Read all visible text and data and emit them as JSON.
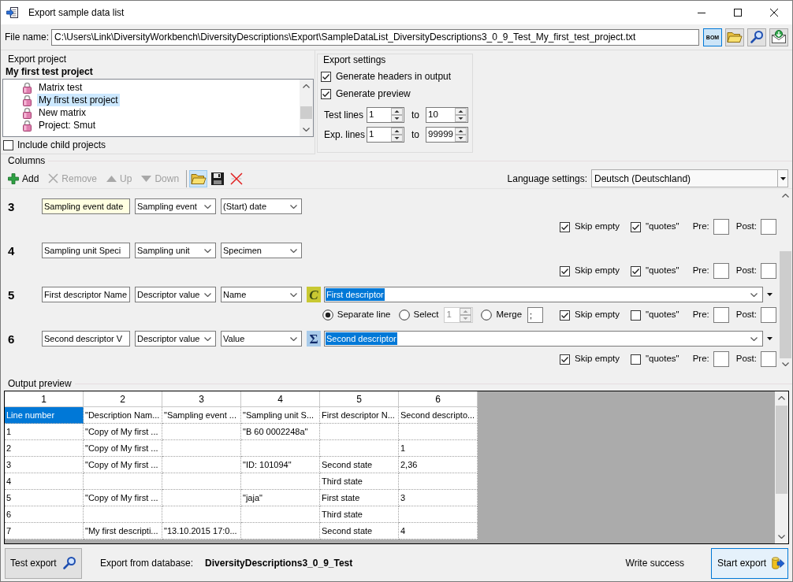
{
  "window": {
    "title": "Export sample data list"
  },
  "file_row": {
    "label": "File name:",
    "path": "C:\\Users\\Link\\DiversityWorkbench\\DiversityDescriptions\\Export\\SampleDataList_DiversityDescriptions3_0_9_Test_My_first_test_project.txt",
    "buttons": [
      {
        "kind": "bom",
        "label": "BOM",
        "pressed": true
      },
      {
        "kind": "folder",
        "pressed": false
      },
      {
        "kind": "search",
        "pressed": false
      },
      {
        "kind": "mail",
        "pressed": false
      }
    ]
  },
  "export_project": {
    "title": "Export project",
    "current": "My first test project",
    "projects": [
      {
        "name": "Matrix test",
        "selected": false
      },
      {
        "name": "My first test project",
        "selected": true
      },
      {
        "name": "New matrix",
        "selected": false
      },
      {
        "name": "Project: Smut",
        "selected": false
      }
    ],
    "include_child": {
      "label": "Include child projects",
      "checked": false
    }
  },
  "export_settings": {
    "title": "Export settings",
    "options": [
      {
        "label": "Generate headers in output",
        "checked": true
      },
      {
        "label": "Generate preview",
        "checked": true
      }
    ],
    "ranges": [
      {
        "label": "Test lines",
        "from": "1",
        "to_label": "to",
        "to": "10"
      },
      {
        "label": "Exp. lines",
        "from": "1",
        "to_label": "to",
        "to": "99999"
      }
    ]
  },
  "columns": {
    "title": "Columns",
    "toolbar": [
      {
        "kind": "add",
        "label": "Add",
        "disabled": false,
        "highlighted": false
      },
      {
        "kind": "remove",
        "label": "Remove",
        "disabled": true,
        "highlighted": false
      },
      {
        "kind": "up",
        "label": "Up",
        "disabled": true,
        "highlighted": false
      },
      {
        "kind": "down",
        "label": "Down",
        "disabled": true,
        "highlighted": false
      },
      {
        "kind": "open",
        "disabled": false,
        "highlighted": true
      },
      {
        "kind": "save",
        "disabled": false,
        "highlighted": false
      },
      {
        "kind": "clear",
        "disabled": false,
        "highlighted": false
      }
    ],
    "language": {
      "label": "Language settings:",
      "value": "Deutsch (Deutschland)"
    },
    "rows": [
      {
        "number": "3",
        "name": "Sampling event date",
        "name_highlighted": true,
        "source": "Sampling event",
        "field": "(Start) date",
        "skip_empty": {
          "label": "Skip empty",
          "checked": true
        },
        "quotes": {
          "label": "\"quotes\"",
          "checked": true
        },
        "pre_label": "Pre:",
        "post_label": "Post:"
      },
      {
        "number": "4",
        "name": "Sampling unit Speci",
        "name_highlighted": false,
        "source": "Sampling unit",
        "field": "Specimen",
        "skip_empty": {
          "label": "Skip empty",
          "checked": true
        },
        "quotes": {
          "label": "\"quotes\"",
          "checked": true
        },
        "pre_label": "Pre:",
        "post_label": "Post:"
      },
      {
        "number": "5",
        "name": "First descriptor Name",
        "name_highlighted": false,
        "source": "Descriptor value",
        "field": "Name",
        "descriptor": {
          "kind": "categorical",
          "symbol": "C",
          "value": "First descriptor",
          "highlighted": true
        },
        "modes": [
          {
            "label": "Separate line",
            "selected": true
          },
          {
            "label": "Select",
            "selected": false
          },
          {
            "label": "Merge",
            "selected": false
          }
        ],
        "select_spinner": {
          "value": "1",
          "disabled": true
        },
        "merge_separator": ";",
        "skip_empty": {
          "label": "Skip empty",
          "checked": true
        },
        "quotes": {
          "label": "\"quotes\"",
          "checked": false
        },
        "pre_label": "Pre:",
        "post_label": "Post:"
      },
      {
        "number": "6",
        "name": "Second descriptor V",
        "name_highlighted": false,
        "source": "Descriptor value",
        "field": "Value",
        "descriptor": {
          "kind": "quantitative",
          "symbol": "Σ",
          "value": "Second descriptor",
          "highlighted": true
        },
        "skip_empty": {
          "label": "Skip empty",
          "checked": true
        },
        "quotes": {
          "label": "\"quotes\"",
          "checked": false
        },
        "pre_label": "Pre:",
        "post_label": "Post:"
      }
    ]
  },
  "output_preview": {
    "title": "Output preview",
    "headers": [
      "1",
      "2",
      "3",
      "4",
      "5",
      "6"
    ],
    "rows": [
      {
        "cells": [
          {
            "text": "Line number",
            "selected": true
          },
          {
            "text": "\"Description Nam...",
            "selected": false
          },
          {
            "text": "\"Sampling event ...",
            "selected": false
          },
          {
            "text": "\"Sampling unit S...",
            "selected": false
          },
          {
            "text": "First descriptor N...",
            "selected": false
          },
          {
            "text": "Second descripto...",
            "selected": false
          }
        ]
      },
      {
        "cells": [
          {
            "text": "1",
            "selected": false
          },
          {
            "text": "\"Copy of My first ...",
            "selected": false
          },
          {
            "selected": false
          },
          {
            "text": "\"B 60 0002248a\"",
            "selected": false
          },
          {
            "selected": false
          },
          {
            "selected": false
          }
        ]
      },
      {
        "cells": [
          {
            "text": "2",
            "selected": false
          },
          {
            "text": "\"Copy of My first ...",
            "selected": false
          },
          {
            "selected": false
          },
          {
            "selected": false
          },
          {
            "selected": false
          },
          {
            "text": "1",
            "selected": false
          }
        ]
      },
      {
        "cells": [
          {
            "text": "3",
            "selected": false
          },
          {
            "text": "\"Copy of My first ...",
            "selected": false
          },
          {
            "selected": false
          },
          {
            "text": "\"ID: 101094\"",
            "selected": false
          },
          {
            "text": "Second state",
            "selected": false
          },
          {
            "text": "2,36",
            "selected": false
          }
        ]
      },
      {
        "cells": [
          {
            "text": "4",
            "selected": false
          },
          {
            "selected": false
          },
          {
            "selected": false
          },
          {
            "selected": false
          },
          {
            "text": "Third state",
            "selected": false
          },
          {
            "selected": false
          }
        ]
      },
      {
        "cells": [
          {
            "text": "5",
            "selected": false
          },
          {
            "text": "\"Copy of My first ...",
            "selected": false
          },
          {
            "selected": false
          },
          {
            "text": "\"jaja\"",
            "selected": false
          },
          {
            "text": "First state",
            "selected": false
          },
          {
            "text": "3",
            "selected": false
          }
        ]
      },
      {
        "cells": [
          {
            "text": "6",
            "selected": false
          },
          {
            "selected": false
          },
          {
            "selected": false
          },
          {
            "selected": false
          },
          {
            "text": "Third state",
            "selected": false
          },
          {
            "selected": false
          }
        ]
      },
      {
        "cells": [
          {
            "text": "7",
            "selected": false
          },
          {
            "text": "\"My first descripti...",
            "selected": false
          },
          {
            "text": "\"13.10.2015 17:0...",
            "selected": false
          },
          {
            "selected": false
          },
          {
            "text": "Second state",
            "selected": false
          },
          {
            "text": "4",
            "selected": false
          }
        ]
      }
    ]
  },
  "footer": {
    "test_export": "Test export",
    "database_label": "Export from database:",
    "database": "DiversityDescriptions3_0_9_Test",
    "status": "Write success",
    "start_export": "Start export"
  }
}
